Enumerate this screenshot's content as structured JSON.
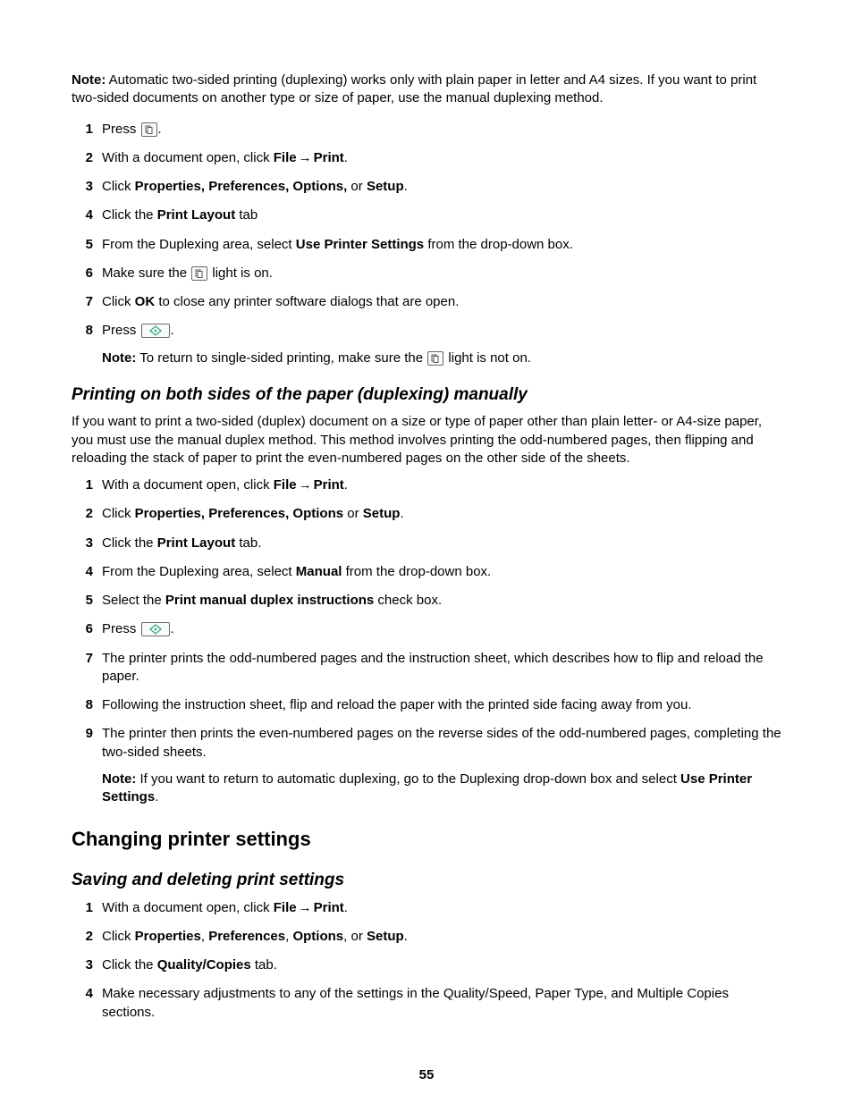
{
  "intro_note_label": "Note:",
  "intro_note_text": " Automatic two-sided printing (duplexing) works only with plain paper in letter and A4 sizes. If you want to print two-sided documents on another type or size of paper, use the manual duplexing method.",
  "listA": {
    "i1": "Press ",
    "i1_end": ".",
    "i2_a": "With a document open, click ",
    "i2_file": "File",
    "i2_arrow": " → ",
    "i2_print": "Print",
    "i2_end": ".",
    "i3_a": "Click ",
    "i3_b": "Properties, Preferences, Options,",
    "i3_c": " or ",
    "i3_d": "Setup",
    "i3_end": ".",
    "i4_a": "Click the ",
    "i4_b": "Print Layout",
    "i4_c": " tab",
    "i5_a": "From the Duplexing area, select ",
    "i5_b": "Use Printer Settings",
    "i5_c": " from the drop-down box.",
    "i6_a": "Make sure the ",
    "i6_b": " light is on.",
    "i7_a": "Click ",
    "i7_b": "OK",
    "i7_c": " to close any printer software dialogs that are open.",
    "i8_a": "Press ",
    "i8_b": ".",
    "i8_note_label": "Note:",
    "i8_note_text": " To return to single-sided printing, make sure the ",
    "i8_note_end": " light is not on."
  },
  "h3_a": "Printing on both sides of the paper (duplexing) manually",
  "para_manual": "If you want to print a two-sided (duplex) document on a size or type of paper other than plain letter- or A4-size paper, you must use the manual duplex method. This method involves printing the odd-numbered pages, then flipping and reloading the stack of paper to print the even-numbered pages on the other side of the sheets.",
  "listB": {
    "i1_a": "With a document open, click ",
    "i1_file": "File",
    "i1_arrow": " → ",
    "i1_print": "Print",
    "i1_end": ".",
    "i2_a": "Click ",
    "i2_b": "Properties, Preferences, Options",
    "i2_c": " or ",
    "i2_d": "Setup",
    "i2_end": ".",
    "i3_a": "Click the ",
    "i3_b": "Print Layout",
    "i3_c": " tab.",
    "i4_a": "From the Duplexing area, select  ",
    "i4_b": "Manual",
    "i4_c": " from the drop-down box.",
    "i5_a": "Select the ",
    "i5_b": "Print manual duplex instructions",
    "i5_c": " check box.",
    "i6_a": "Press ",
    "i6_b": ".",
    "i7": "The printer prints the odd-numbered pages and the instruction sheet, which describes how to flip and reload the paper.",
    "i8": "Following the instruction sheet, flip and reload the paper with the printed side facing away from you.",
    "i9": "The printer then prints the even-numbered pages on the reverse sides of the odd-numbered pages, completing the two-sided sheets.",
    "i9_note_label": "Note:",
    "i9_note_a": " If you want to return to automatic duplexing, go to the Duplexing drop-down box and select ",
    "i9_note_b": "Use Printer Settings",
    "i9_note_c": "."
  },
  "h2": "Changing printer settings",
  "h3_b": "Saving and deleting print settings",
  "listC": {
    "i1_a": "With a document open, click ",
    "i1_file": "File",
    "i1_arrow": " → ",
    "i1_print": "Print",
    "i1_end": ".",
    "i2_a": "Click ",
    "i2_b": "Properties",
    "i2_c": ", ",
    "i2_d": "Preferences",
    "i2_e": ", ",
    "i2_f": "Options",
    "i2_g": ", or ",
    "i2_h": "Setup",
    "i2_end": ".",
    "i3_a": "Click the ",
    "i3_b": "Quality/Copies",
    "i3_c": " tab.",
    "i4": "Make necessary adjustments to any of the settings in the Quality/Speed, Paper Type, and Multiple Copies sections."
  },
  "page_number": "55",
  "nums": {
    "n1": "1",
    "n2": "2",
    "n3": "3",
    "n4": "4",
    "n5": "5",
    "n6": "6",
    "n7": "7",
    "n8": "8",
    "n9": "9"
  }
}
